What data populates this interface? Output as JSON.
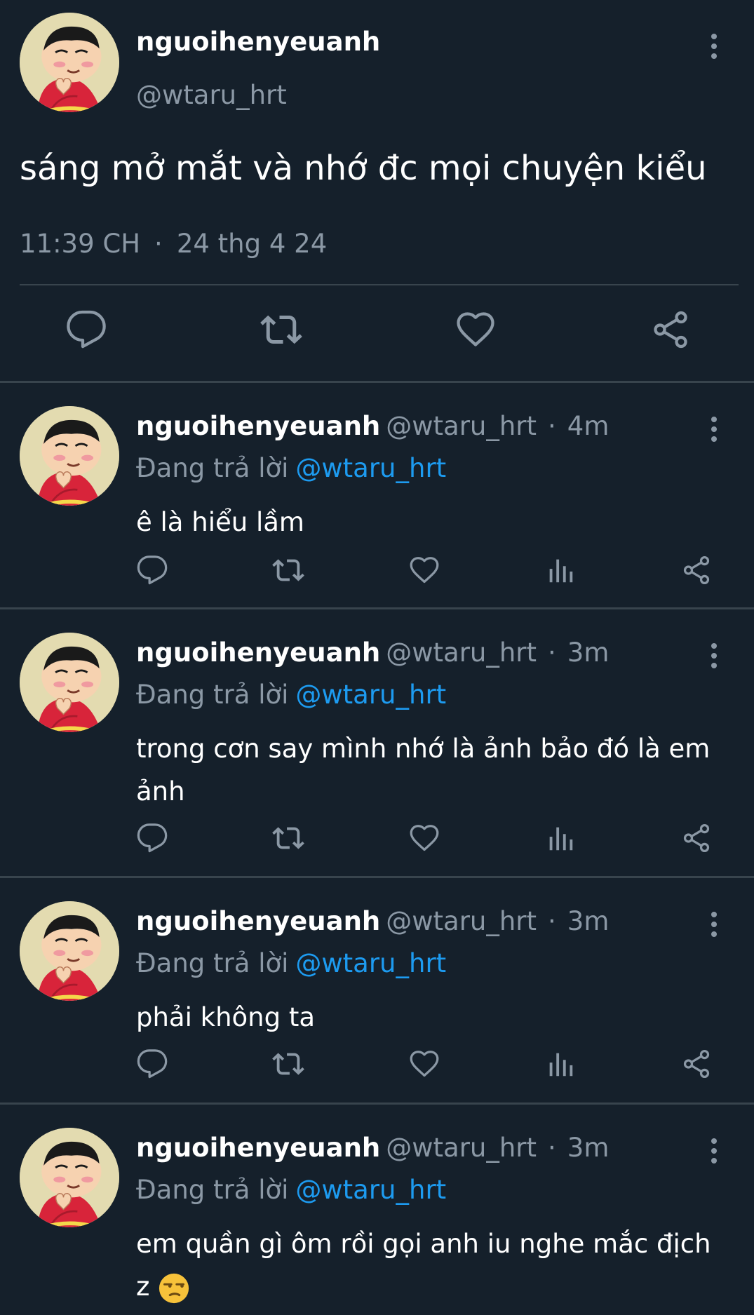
{
  "main_tweet": {
    "display_name": "nguoihenyeuanh",
    "handle": "@wtaru_hrt",
    "text": "sáng mở mắt và nhớ đc mọi chuyện kiểu",
    "time": "11:39 CH",
    "separator": "·",
    "date": "24 thg 4 24",
    "icons": [
      "reply-icon",
      "retweet-icon",
      "like-icon",
      "share-icon"
    ]
  },
  "replies": [
    {
      "display_name": "nguoihenyeuanh",
      "handle": "@wtaru_hrt",
      "separator": "·",
      "time": "4m",
      "replying_label": "Đang trả lời",
      "replying_to": "@wtaru_hrt",
      "text": "ê là hiểu lầm"
    },
    {
      "display_name": "nguoihenyeuanh",
      "handle": "@wtaru_hrt",
      "separator": "·",
      "time": "3m",
      "replying_label": "Đang trả lời",
      "replying_to": "@wtaru_hrt",
      "text": "trong cơn say mình nhớ là ảnh bảo đó là em ảnh"
    },
    {
      "display_name": "nguoihenyeuanh",
      "handle": "@wtaru_hrt",
      "separator": "·",
      "time": "3m",
      "replying_label": "Đang trả lời",
      "replying_to": "@wtaru_hrt",
      "text": "phải không ta"
    },
    {
      "display_name": "nguoihenyeuanh",
      "handle": "@wtaru_hrt",
      "separator": "·",
      "time": "3m",
      "replying_label": "Đang trả lời",
      "replying_to": "@wtaru_hrt",
      "text": "em quần gì ôm rồi gọi anh iu nghe mắc địch z",
      "emoji": "unamused-face-emoji"
    }
  ],
  "reply_action_icons": [
    "reply-icon",
    "retweet-icon",
    "like-icon",
    "views-icon",
    "share-icon"
  ],
  "colors": {
    "background": "#15202b",
    "divider": "#38444d",
    "secondary_text": "#8b98a5",
    "mention": "#1d9bf0"
  }
}
